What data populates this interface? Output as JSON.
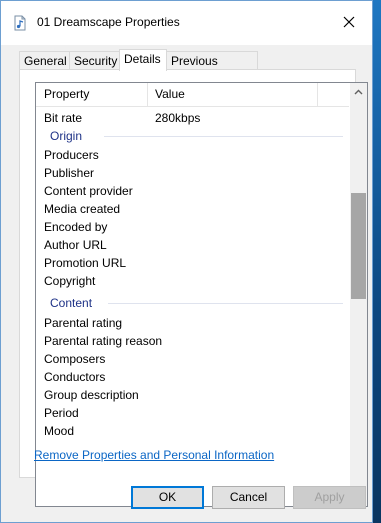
{
  "window": {
    "title": "01 Dreamscape Properties",
    "icons": {
      "file": "audio-file-icon",
      "close": "close-icon"
    }
  },
  "tabs": [
    {
      "label": "General",
      "active": false
    },
    {
      "label": "Security",
      "active": false
    },
    {
      "label": "Details",
      "active": true
    },
    {
      "label": "Previous Versions",
      "active": false
    }
  ],
  "details": {
    "columns": {
      "property": "Property",
      "value": "Value"
    },
    "top_row": {
      "name": "Bit rate",
      "value": "280kbps"
    },
    "origin": {
      "heading": "Origin",
      "items": [
        "Producers",
        "Publisher",
        "Content provider",
        "Media created",
        "Encoded by",
        "Author URL",
        "Promotion URL",
        "Copyright"
      ]
    },
    "content": {
      "heading": "Content",
      "items": [
        "Parental rating",
        "Parental rating reason",
        "Composers",
        "Conductors",
        "Group description",
        "Period",
        "Mood"
      ]
    },
    "scroll": {
      "up_icon": "chevron-up-icon",
      "down_icon": "chevron-down-icon"
    }
  },
  "link": {
    "label": "Remove Properties and Personal Information"
  },
  "buttons": {
    "ok": "OK",
    "cancel": "Cancel",
    "apply": "Apply"
  },
  "colors": {
    "accent": "#0078d7",
    "link": "#0b66c5",
    "group_heading": "#1e3287"
  }
}
